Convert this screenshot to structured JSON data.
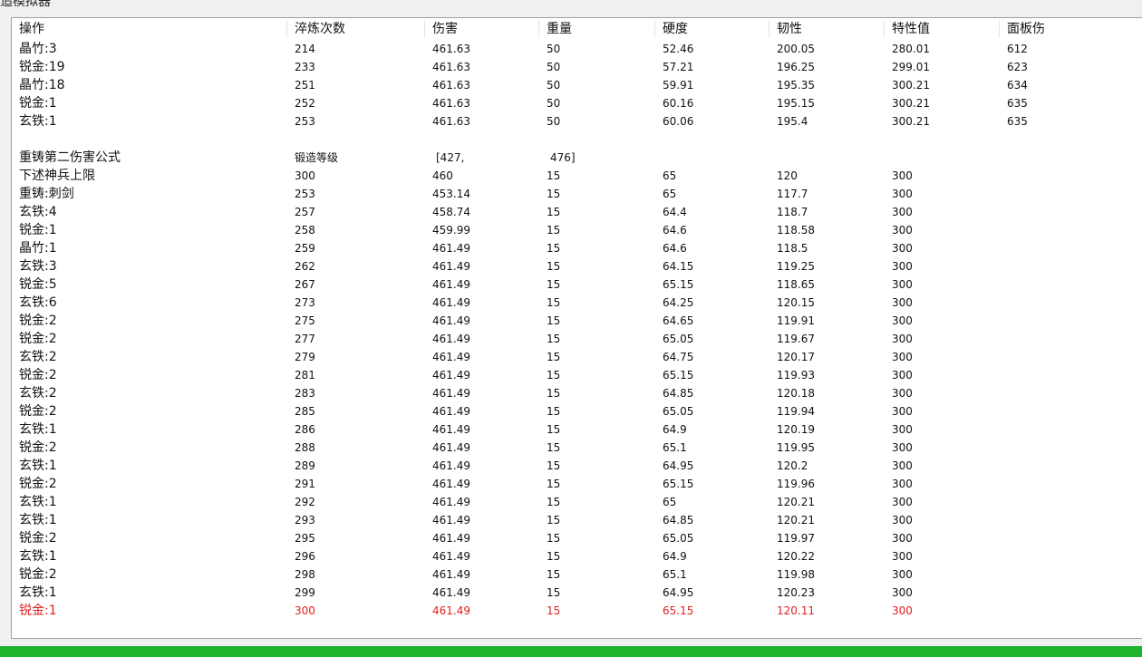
{
  "window": {
    "title": "追模拟器"
  },
  "header": [
    "操作",
    "淬炼次数",
    "伤害",
    "重量",
    "硬度",
    "韧性",
    "特性值",
    "面板伤"
  ],
  "section1": [
    [
      "晶竹:3",
      "214",
      "461.63",
      "50",
      "52.46",
      "200.05",
      "280.01",
      "612"
    ],
    [
      "锐金:19",
      "233",
      "461.63",
      "50",
      "57.21",
      "196.25",
      "299.01",
      "623"
    ],
    [
      "晶竹:18",
      "251",
      "461.63",
      "50",
      "59.91",
      "195.35",
      "300.21",
      "634"
    ],
    [
      "锐金:1",
      "252",
      "461.63",
      "50",
      "60.16",
      "195.15",
      "300.21",
      "635"
    ],
    [
      "玄铁:1",
      "253",
      "461.63",
      "50",
      "60.06",
      "195.4",
      "300.21",
      "635"
    ]
  ],
  "section2_header": [
    "重铸第二伤害公式",
    "锻造等级",
    "[427,",
    "476]",
    "",
    "",
    "",
    ""
  ],
  "section2": [
    [
      "下述神兵上限",
      "300",
      "460",
      "15",
      "65",
      "120",
      "300",
      ""
    ],
    [
      "重铸:刺剑",
      "253",
      "453.14",
      "15",
      "65",
      "117.7",
      "300",
      ""
    ],
    [
      "玄铁:4",
      "257",
      "458.74",
      "15",
      "64.4",
      "118.7",
      "300",
      ""
    ],
    [
      "锐金:1",
      "258",
      "459.99",
      "15",
      "64.6",
      "118.58",
      "300",
      ""
    ],
    [
      "晶竹:1",
      "259",
      "461.49",
      "15",
      "64.6",
      "118.5",
      "300",
      ""
    ],
    [
      "玄铁:3",
      "262",
      "461.49",
      "15",
      "64.15",
      "119.25",
      "300",
      ""
    ],
    [
      "锐金:5",
      "267",
      "461.49",
      "15",
      "65.15",
      "118.65",
      "300",
      ""
    ],
    [
      "玄铁:6",
      "273",
      "461.49",
      "15",
      "64.25",
      "120.15",
      "300",
      ""
    ],
    [
      "锐金:2",
      "275",
      "461.49",
      "15",
      "64.65",
      "119.91",
      "300",
      ""
    ],
    [
      "锐金:2",
      "277",
      "461.49",
      "15",
      "65.05",
      "119.67",
      "300",
      ""
    ],
    [
      "玄铁:2",
      "279",
      "461.49",
      "15",
      "64.75",
      "120.17",
      "300",
      ""
    ],
    [
      "锐金:2",
      "281",
      "461.49",
      "15",
      "65.15",
      "119.93",
      "300",
      ""
    ],
    [
      "玄铁:2",
      "283",
      "461.49",
      "15",
      "64.85",
      "120.18",
      "300",
      ""
    ],
    [
      "锐金:2",
      "285",
      "461.49",
      "15",
      "65.05",
      "119.94",
      "300",
      ""
    ],
    [
      "玄铁:1",
      "286",
      "461.49",
      "15",
      "64.9",
      "120.19",
      "300",
      ""
    ],
    [
      "锐金:2",
      "288",
      "461.49",
      "15",
      "65.1",
      "119.95",
      "300",
      ""
    ],
    [
      "玄铁:1",
      "289",
      "461.49",
      "15",
      "64.95",
      "120.2",
      "300",
      ""
    ],
    [
      "锐金:2",
      "291",
      "461.49",
      "15",
      "65.15",
      "119.96",
      "300",
      ""
    ],
    [
      "玄铁:1",
      "292",
      "461.49",
      "15",
      "65",
      "120.21",
      "300",
      ""
    ],
    [
      "玄铁:1",
      "293",
      "461.49",
      "15",
      "64.85",
      "120.21",
      "300",
      ""
    ],
    [
      "锐金:2",
      "295",
      "461.49",
      "15",
      "65.05",
      "119.97",
      "300",
      ""
    ],
    [
      "玄铁:1",
      "296",
      "461.49",
      "15",
      "64.9",
      "120.22",
      "300",
      ""
    ],
    [
      "锐金:2",
      "298",
      "461.49",
      "15",
      "65.1",
      "119.98",
      "300",
      ""
    ],
    [
      "玄铁:1",
      "299",
      "461.49",
      "15",
      "64.95",
      "120.23",
      "300",
      ""
    ],
    [
      "锐金:1",
      "300",
      "461.49",
      "15",
      "65.15",
      "120.11",
      "300",
      ""
    ]
  ],
  "colors": {
    "highlight_row": "#e02020",
    "status_bar": "#1db32c"
  }
}
